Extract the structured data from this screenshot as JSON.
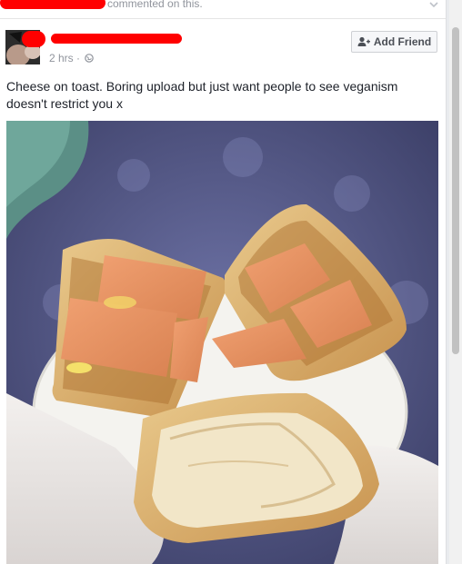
{
  "story": {
    "activity_text": "commented on this."
  },
  "post": {
    "timestamp": "2 hrs",
    "privacy_icon": "globe-icon",
    "add_friend_label": "Add Friend",
    "body": "Cheese on toast. Boring upload but just want people to see veganism doesn't restrict you x"
  },
  "colors": {
    "redaction": "#ff0000",
    "link": "#4b4f56",
    "meta": "#90949c"
  }
}
